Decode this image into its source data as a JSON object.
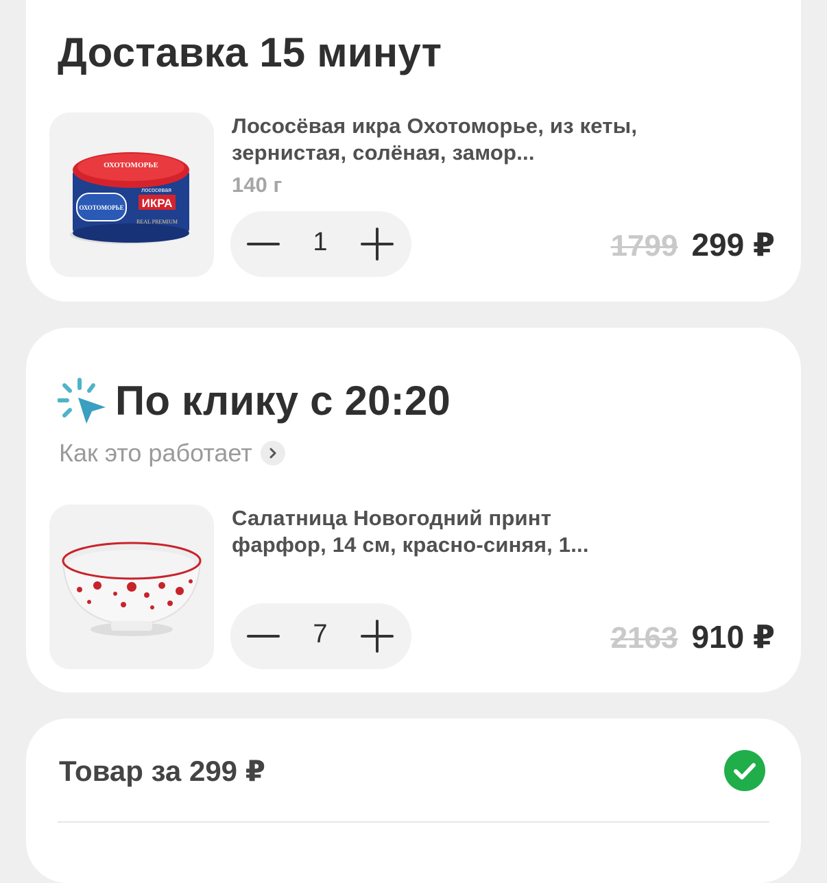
{
  "delivery_section": {
    "title": "Доставка 15 минут",
    "product": {
      "name": "Лососёвая икра Охотоморье, из кеты, зернистая, солёная, замор...",
      "weight": "140 г",
      "quantity": "1",
      "old_price": "1799",
      "price": "299 ₽",
      "image_brand": "ОХОТОМОРЬЕ",
      "image_label": "ИКРА",
      "image_sub": "лососевая",
      "image_grade": "REAL PREMIUM"
    }
  },
  "click_section": {
    "title": "По клику с 20:20",
    "how_it_works": "Как это работает",
    "product": {
      "name": "Салатница Новогодний принт фарфор, 14 см, красно-синяя, 1...",
      "quantity": "7",
      "old_price": "2163",
      "price": "910 ₽"
    }
  },
  "summary": {
    "item_text": "Товар за 299 ₽",
    "checked": true
  },
  "colors": {
    "accent_green": "#1fae4a",
    "click_icon_teal": "#4fb3c8"
  }
}
